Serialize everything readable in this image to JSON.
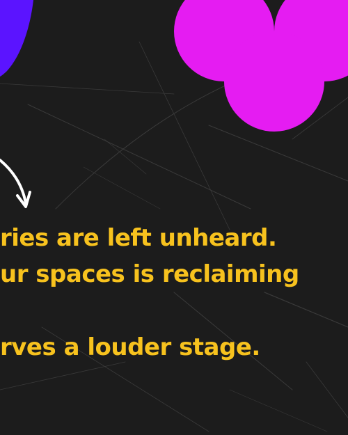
{
  "colors": {
    "background": "#1c1c1c",
    "scratch": "#3a3a3a",
    "blob": "#5b14ff",
    "flower": "#e51cf2",
    "arrow": "#ffffff",
    "text": "#f7c21e"
  },
  "icons": [
    "purple-blob",
    "magenta-circle-pattern",
    "curved-arrow-icon"
  ],
  "message": {
    "lines": [
      "ries are left unheard.",
      "ur spaces is reclaiming",
      "rves a louder stage."
    ]
  }
}
